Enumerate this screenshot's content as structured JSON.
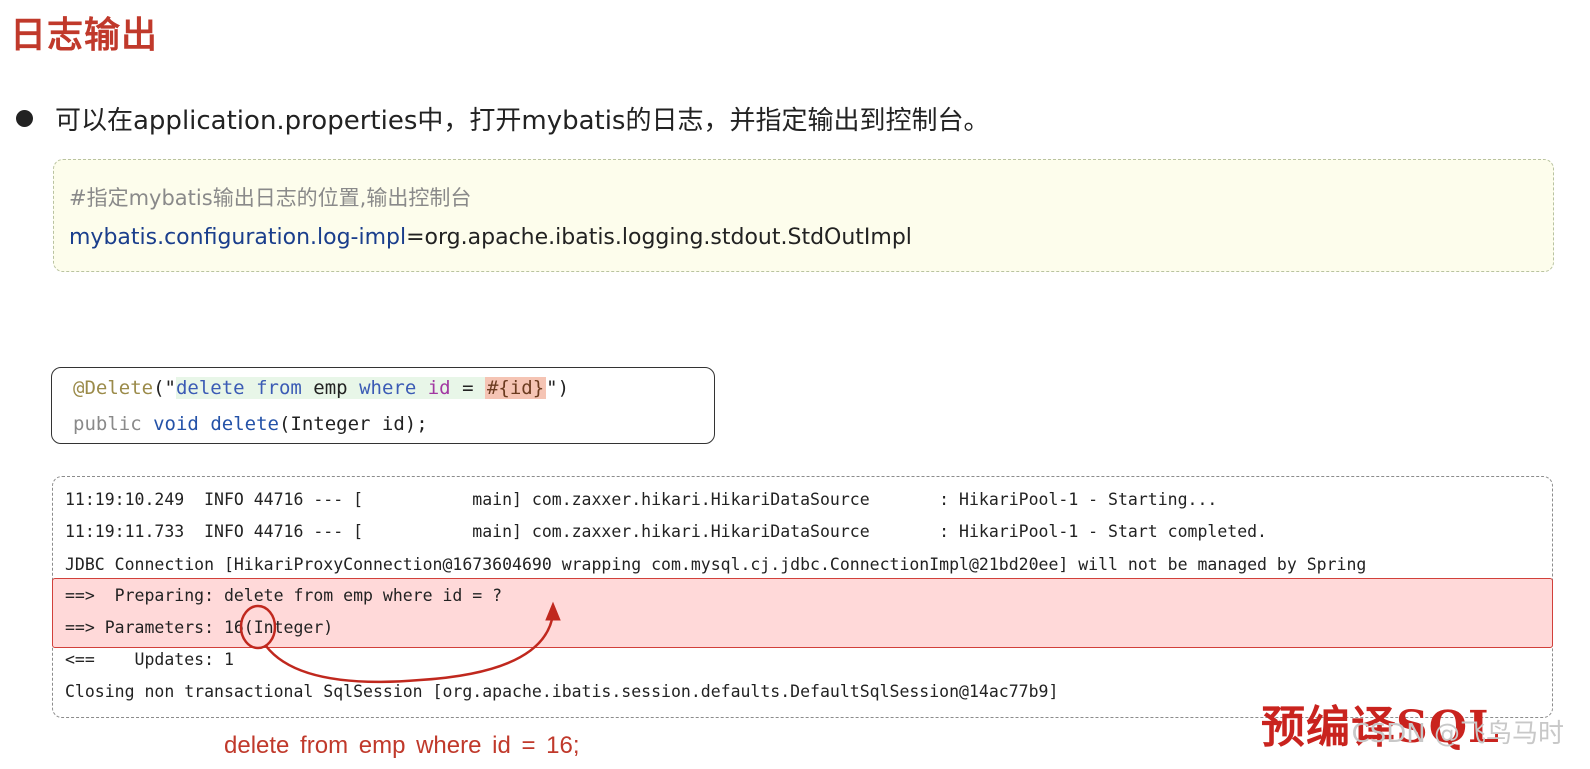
{
  "title": "日志输出",
  "bullet": "可以在application.properties中，打开mybatis的日志，并指定输出到控制台。",
  "properties": {
    "comment": "#指定mybatis输出日志的位置,输出控制台",
    "key": "mybatis.configuration.log-impl",
    "value": "=org.apache.ibatis.logging.stdout.StdOutImpl"
  },
  "code": {
    "annotation": "@Delete",
    "paren_open": "(\"",
    "str_delete": "delete",
    "str_from": "from",
    "str_emp": "emp",
    "str_where": "where",
    "str_id": "id",
    "str_eq": "=",
    "placeholder": "#{id}",
    "paren_close": "\")",
    "line2_public": "public",
    "line2_void": "void",
    "line2_delete": "delete",
    "line2_rest": "(Integer id);"
  },
  "log": {
    "lines": [
      "11:19:10.249  INFO 44716 --- [           main] com.zaxxer.hikari.HikariDataSource       : HikariPool-1 - Starting...",
      "11:19:11.733  INFO 44716 --- [           main] com.zaxxer.hikari.HikariDataSource       : HikariPool-1 - Start completed.",
      "JDBC Connection [HikariProxyConnection@1673604690 wrapping com.mysql.cj.jdbc.ConnectionImpl@21bd20ee] will not be managed by Spring",
      "==>  Preparing: delete from emp where id = ?",
      "==> Parameters: 16(Integer)",
      "<==    Updates: 1",
      "Closing non transactional SqlSession [org.apache.ibatis.session.defaults.DefaultSqlSession@14ac77b9]"
    ],
    "annotation_label": "预编译SQL"
  },
  "result_sql": "delete  from  emp  where  id = 16;",
  "watermark": "CSDN @飞鸟马时",
  "colors": {
    "title": "#c0392b",
    "highlight_border": "#d2403a",
    "arrow": "#c0281e"
  }
}
